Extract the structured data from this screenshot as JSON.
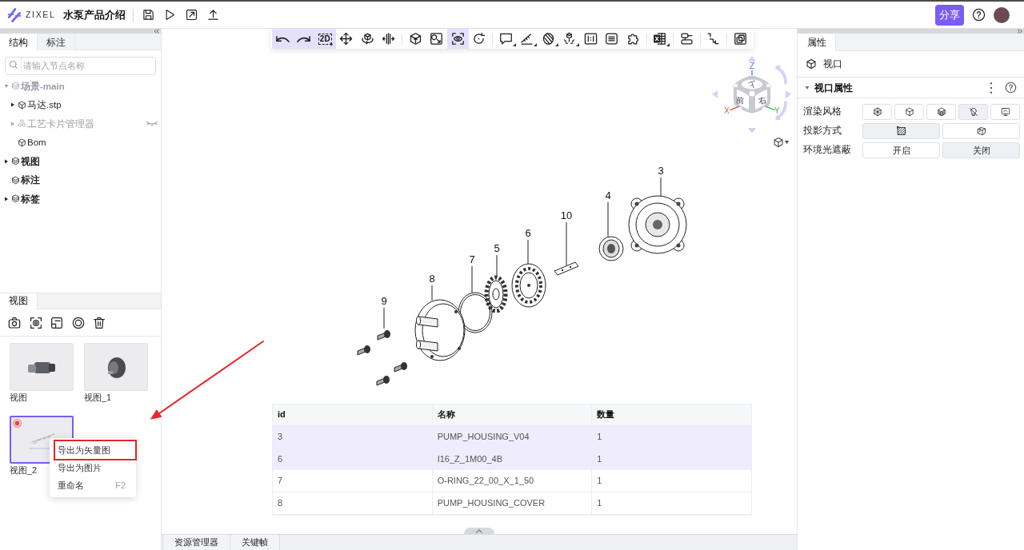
{
  "header": {
    "logo_text": "ZIXEL",
    "title": "水泵产品介绍",
    "share_label": "分享"
  },
  "structure_panel": {
    "tabs": [
      {
        "label": "结构",
        "selected": true
      },
      {
        "label": "标注",
        "selected": false
      }
    ],
    "search": {
      "placeholder": "请输入节点名称"
    },
    "tree": [
      {
        "label": "场景-main",
        "kind": "group",
        "expanded": true,
        "dimmed": true,
        "hidden": false,
        "children": [
          {
            "label": "马达.stp",
            "kind": "part",
            "expanded": false,
            "dimmed": false,
            "hidden": false
          },
          {
            "label": "工艺卡片管理器",
            "kind": "cluster",
            "expanded": false,
            "dimmed": true,
            "hidden": true
          },
          {
            "label": "Bom",
            "kind": "part",
            "dimmed": false,
            "hidden": false
          }
        ]
      },
      {
        "label": "视图",
        "kind": "group",
        "expanded": false,
        "dimmed": false,
        "hidden": false
      },
      {
        "label": "标注",
        "kind": "group",
        "dimmed": false,
        "hidden": false
      },
      {
        "label": "标签",
        "kind": "group",
        "expanded": false,
        "dimmed": false,
        "hidden": false
      }
    ]
  },
  "views_panel": {
    "tabs": [
      {
        "label": "视图",
        "selected": true
      }
    ],
    "views": [
      {
        "label": "视图",
        "selected": false
      },
      {
        "label": "视图_1",
        "selected": false
      },
      {
        "label": "视图_2",
        "selected": true
      }
    ]
  },
  "context_menu": {
    "items": [
      {
        "label": "导出为矢量图",
        "annotated": true
      },
      {
        "label": "导出为图片",
        "annotated": false
      },
      {
        "label": "重命名",
        "shortcut": "F2",
        "annotated": false
      }
    ]
  },
  "viewport_toolbar": {
    "groups": [
      {
        "buttons": [
          {
            "selected": true,
            "dropdown": false
          },
          {
            "selected": true,
            "dropdown": false
          },
          {
            "selected": true,
            "dropdown": false,
            "label": "2D"
          },
          {
            "selected": false,
            "dropdown": false
          },
          {
            "selected": false,
            "dropdown": false
          },
          {
            "selected": false,
            "dropdown": false
          }
        ]
      },
      {
        "buttons": [
          {
            "selected": false,
            "dropdown": false
          },
          {
            "selected": false,
            "dropdown": false
          },
          {
            "selected": true,
            "dropdown": false
          },
          {
            "selected": false,
            "dropdown": false
          }
        ]
      },
      {
        "buttons": [
          {
            "selected": false,
            "dropdown": true
          },
          {
            "selected": false,
            "dropdown": true
          },
          {
            "selected": false,
            "dropdown": true
          },
          {
            "selected": false,
            "dropdown": true
          },
          {
            "selected": false,
            "dropdown": false
          },
          {
            "selected": false,
            "dropdown": false
          },
          {
            "selected": false,
            "dropdown": false
          }
        ]
      },
      {
        "buttons": [
          {
            "selected": false,
            "dropdown": true
          }
        ]
      },
      {
        "buttons": [
          {
            "selected": false,
            "dropdown": false
          }
        ]
      },
      {
        "buttons": [
          {
            "selected": false,
            "dropdown": false
          }
        ]
      },
      {
        "buttons": [
          {
            "selected": false,
            "dropdown": false
          }
        ]
      }
    ]
  },
  "view_cube": {
    "faces": [
      "上",
      "前",
      "右"
    ],
    "axes": [
      "X",
      "Y",
      "Z"
    ]
  },
  "exploded_view": {
    "callouts": [
      "3",
      "4",
      "10",
      "6",
      "5",
      "7",
      "8",
      "9"
    ]
  },
  "bom_table": {
    "columns": [
      "id",
      "名称",
      "数量"
    ],
    "rows": [
      {
        "cells": [
          "3",
          "PUMP_HOUSING_V04",
          "1"
        ],
        "selected": true
      },
      {
        "cells": [
          "6",
          "I16_Z_1M00_4B",
          "1"
        ],
        "selected": true
      },
      {
        "cells": [
          "7",
          "O-RING_22_00_X_1_50",
          "1"
        ],
        "selected": false
      },
      {
        "cells": [
          "8",
          "PUMP_HOUSING_COVER",
          "1"
        ],
        "selected": false
      }
    ]
  },
  "bottom_tabs": [
    {
      "label": "资源管理器"
    },
    {
      "label": "关键帧"
    }
  ],
  "properties_panel": {
    "tabs": [
      {
        "label": "属性",
        "selected": true
      }
    ],
    "object": {
      "label": "视口"
    },
    "section": {
      "title": "视口属性",
      "expanded": true
    },
    "rows": [
      {
        "label": "渲染风格",
        "kind": "icons",
        "options": [
          {
            "selected": false
          },
          {
            "selected": false
          },
          {
            "selected": false
          },
          {
            "selected": true
          },
          {
            "selected": false
          }
        ]
      },
      {
        "label": "投影方式",
        "kind": "icons",
        "options": [
          {
            "selected": true
          },
          {
            "selected": false
          }
        ]
      },
      {
        "label": "环境光遮蔽",
        "kind": "text",
        "options": [
          {
            "label": "开启",
            "selected": false
          },
          {
            "label": "关闭",
            "selected": true
          }
        ]
      }
    ]
  }
}
